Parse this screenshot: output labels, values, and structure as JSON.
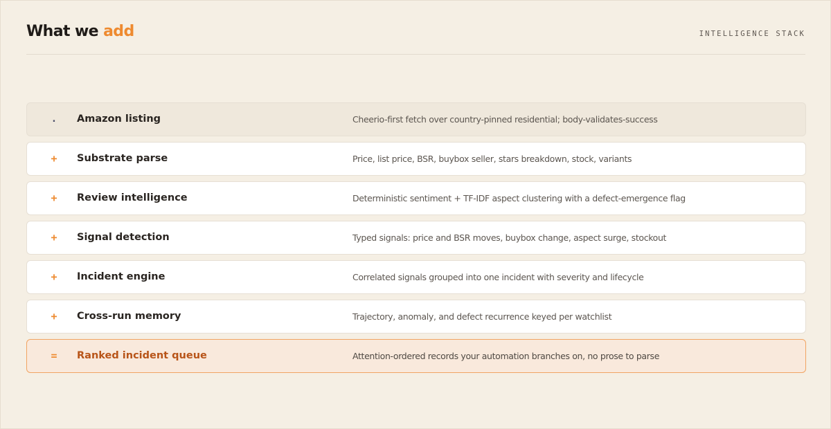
{
  "header": {
    "title_main": "What we",
    "title_accent": "add",
    "kicker": "INTELLIGENCE STACK"
  },
  "colors": {
    "background": "#f5efe4",
    "accent": "#ee8a2f",
    "output_text": "#b85418",
    "output_border": "#f1a462",
    "output_background": "#f9e9dc",
    "source_background": "#efe8dc"
  },
  "rows": [
    {
      "marker": ".",
      "label": "Amazon listing",
      "description": "Cheerio-first fetch over country-pinned residential; body-validates-success",
      "kind": "source"
    },
    {
      "marker": "+",
      "label": "Substrate parse",
      "description": "Price, list price, BSR, buybox seller, stars breakdown, stock, variants",
      "kind": "step"
    },
    {
      "marker": "+",
      "label": "Review intelligence",
      "description": "Deterministic sentiment + TF-IDF aspect clustering with a defect-emergence flag",
      "kind": "step"
    },
    {
      "marker": "+",
      "label": "Signal detection",
      "description": "Typed signals: price and BSR moves, buybox change, aspect surge, stockout",
      "kind": "step"
    },
    {
      "marker": "+",
      "label": "Incident engine",
      "description": "Correlated signals grouped into one incident with severity and lifecycle",
      "kind": "step"
    },
    {
      "marker": "+",
      "label": "Cross-run memory",
      "description": "Trajectory, anomaly, and defect recurrence keyed per watchlist",
      "kind": "step"
    },
    {
      "marker": "=",
      "label": "Ranked incident queue",
      "description": "Attention-ordered records your automation branches on, no prose to parse",
      "kind": "output"
    }
  ]
}
